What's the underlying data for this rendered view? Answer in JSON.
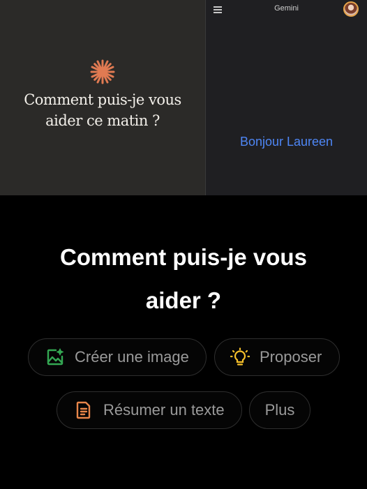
{
  "claude": {
    "greeting": "Comment puis-je vous\naider ce matin ?",
    "accent_color": "#e07a52"
  },
  "gemini": {
    "title": "Gemini",
    "greeting": "Bonjour Laureen",
    "greeting_color": "#4e86f5"
  },
  "main": {
    "heading": "Comment puis-je vous\naider ?",
    "suggestions": [
      {
        "label": "Créer une image",
        "icon": "image-sparkle-icon",
        "color": "#34a853"
      },
      {
        "label": "Proposer",
        "icon": "lightbulb-icon",
        "color": "#f6c02b"
      },
      {
        "label": "Résumer un texte",
        "icon": "document-icon",
        "color": "#e8864a"
      },
      {
        "label": "Plus",
        "icon": ""
      }
    ]
  }
}
